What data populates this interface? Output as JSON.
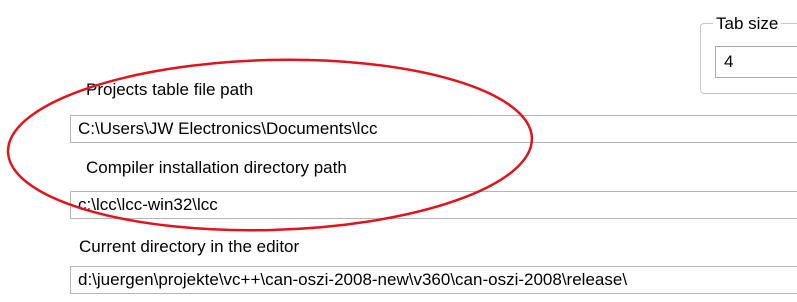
{
  "tab_size": {
    "legend": "Tab size",
    "value": "4"
  },
  "projects_table": {
    "label": "Projects table file path",
    "value": "C:\\Users\\JW Electronics\\Documents\\lcc"
  },
  "compiler_dir": {
    "label": "Compiler installation directory path",
    "value": "c:\\lcc\\lcc-win32\\lcc"
  },
  "current_dir": {
    "label": "Current directory in the editor",
    "value": "d:\\juergen\\projekte\\vc++\\can-oszi-2008-new\\v360\\can-oszi-2008\\release\\"
  },
  "annotation": {
    "shape": "ellipse",
    "color": "#e0141e"
  }
}
